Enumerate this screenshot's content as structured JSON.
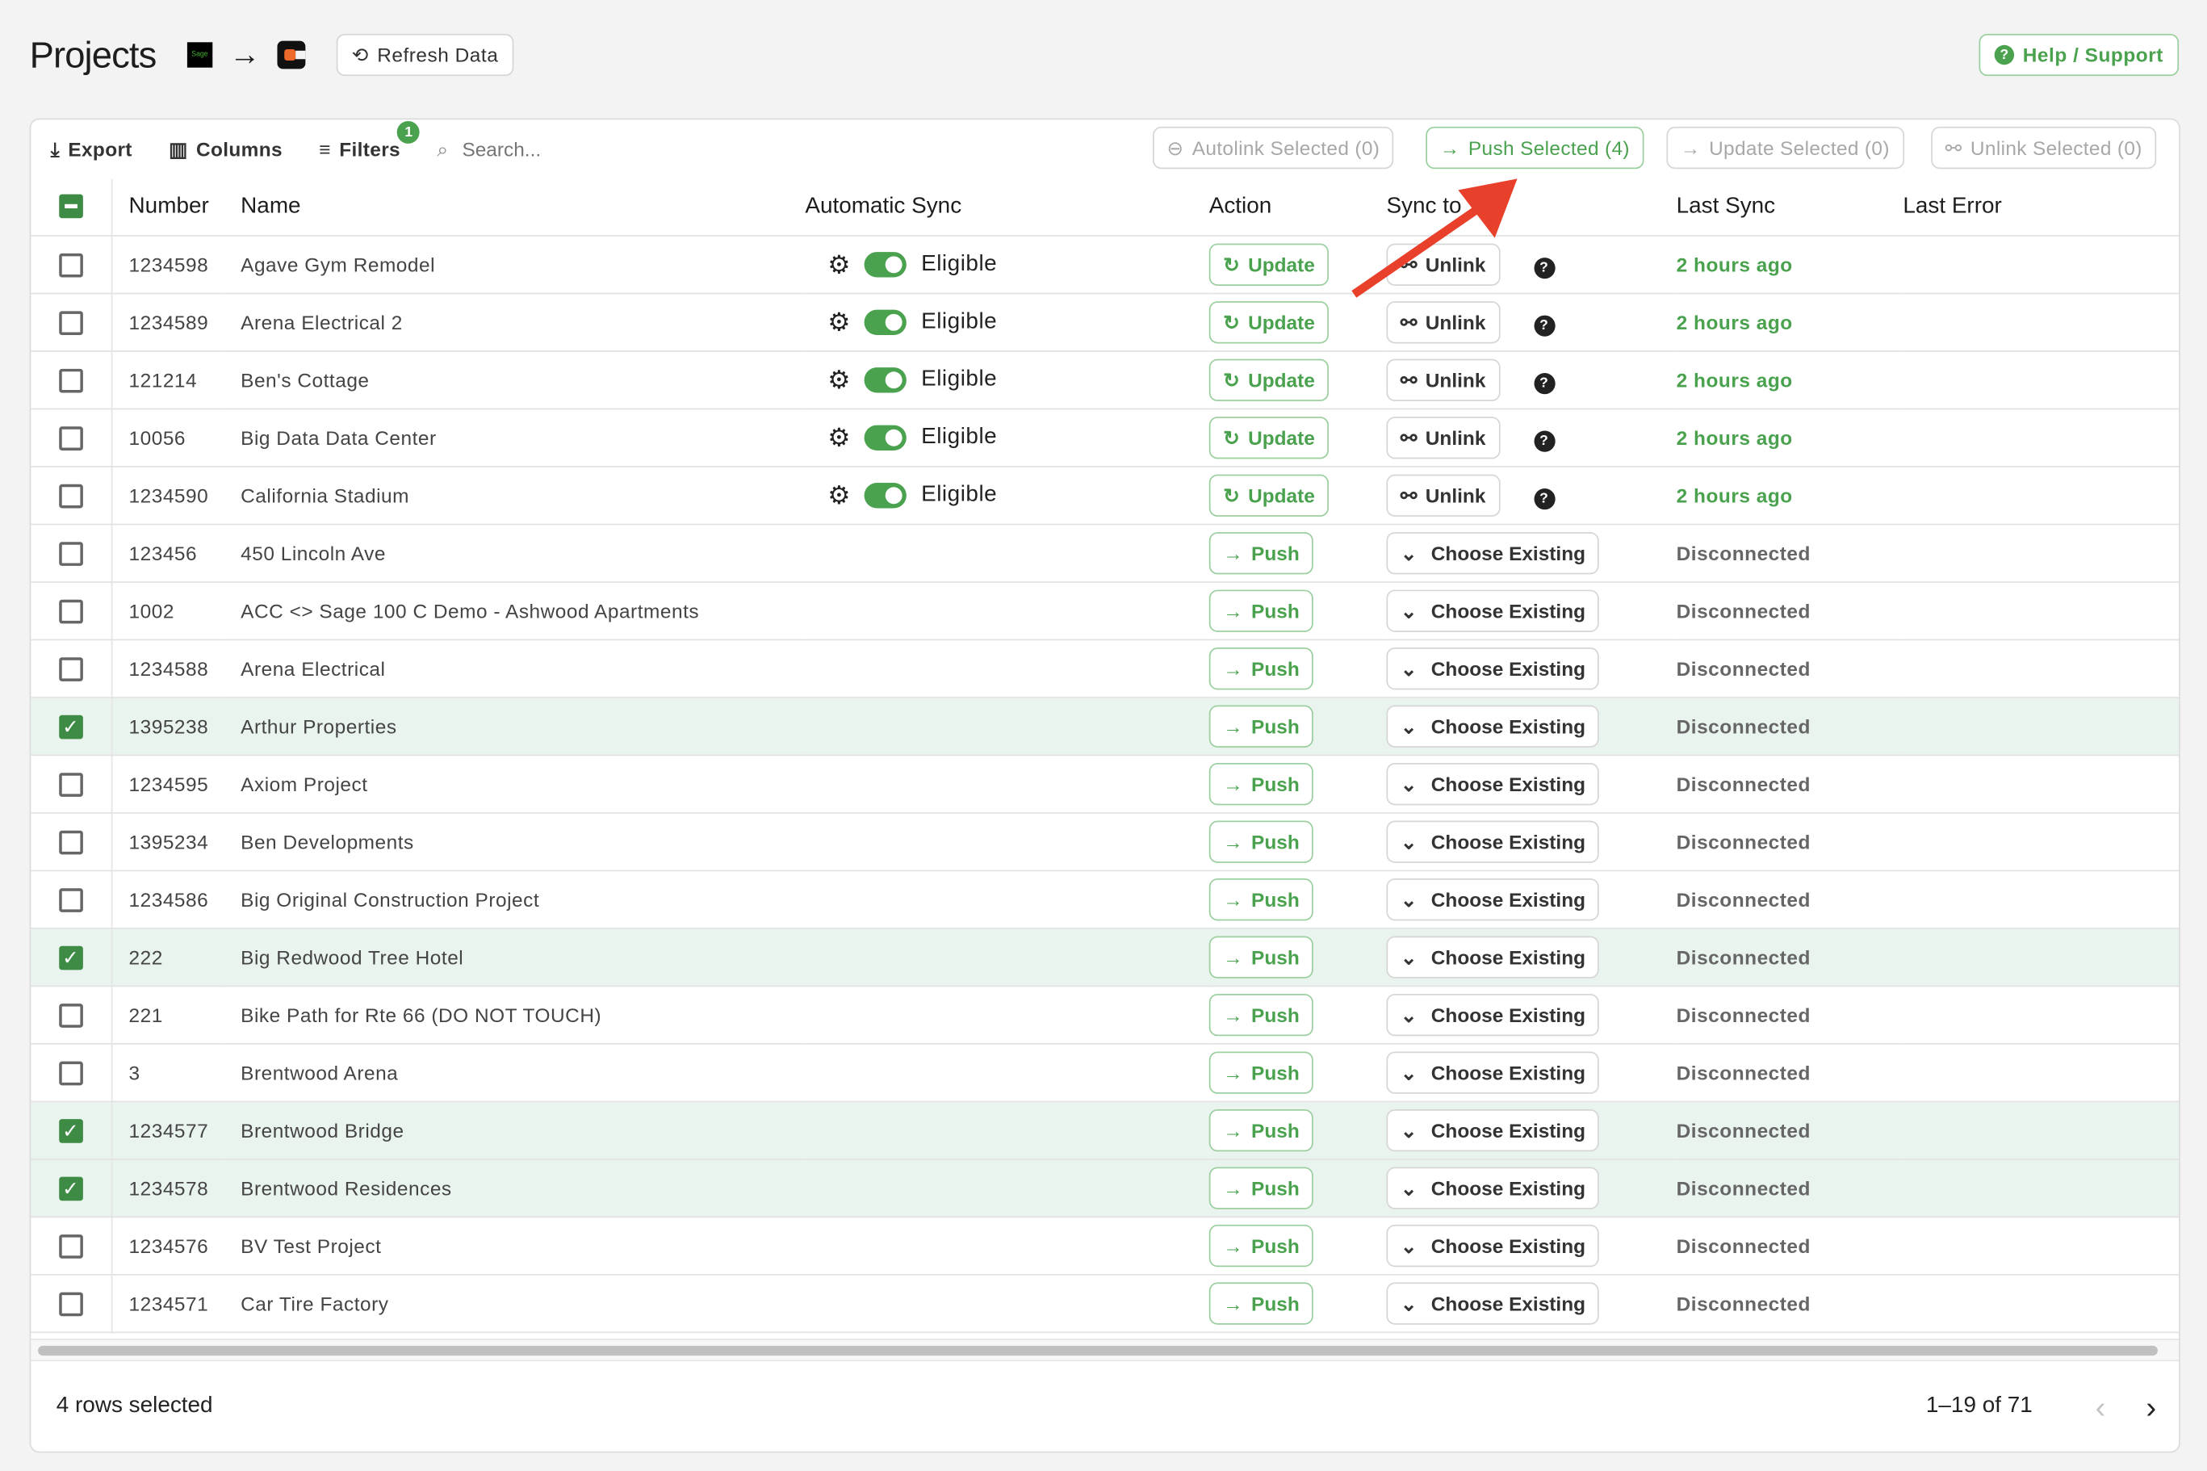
{
  "header": {
    "title": "Projects",
    "source_logo": "Sage",
    "refresh_label": "Refresh Data",
    "help_label": "Help / Support"
  },
  "toolbar": {
    "export_label": "Export",
    "columns_label": "Columns",
    "filters_label": "Filters",
    "filters_count": "1",
    "search_placeholder": "Search...",
    "autolink_label": "Autolink Selected (0)",
    "push_label": "Push Selected (4)",
    "update_label": "Update Selected (0)",
    "unlink_label": "Unlink Selected (0)"
  },
  "columns": [
    "Number",
    "Name",
    "Automatic Sync",
    "Action",
    "Sync to",
    "Last Sync",
    "Last Error"
  ],
  "labels": {
    "eligible": "Eligible",
    "update": "Update",
    "unlink": "Unlink",
    "push": "Push",
    "choose_existing": "Choose Existing"
  },
  "rows": [
    {
      "number": "1234598",
      "name": "Agave Gym Remodel",
      "linked": true,
      "selected": false,
      "last_sync": "2 hours ago"
    },
    {
      "number": "1234589",
      "name": "Arena Electrical 2",
      "linked": true,
      "selected": false,
      "last_sync": "2 hours ago"
    },
    {
      "number": "121214",
      "name": "Ben's Cottage",
      "linked": true,
      "selected": false,
      "last_sync": "2 hours ago"
    },
    {
      "number": "10056",
      "name": "Big Data Data Center",
      "linked": true,
      "selected": false,
      "last_sync": "2 hours ago"
    },
    {
      "number": "1234590",
      "name": "California Stadium",
      "linked": true,
      "selected": false,
      "last_sync": "2 hours ago"
    },
    {
      "number": "123456",
      "name": "450 Lincoln Ave",
      "linked": false,
      "selected": false,
      "last_sync": "Disconnected"
    },
    {
      "number": "1002",
      "name": "ACC <> Sage 100 C Demo - Ashwood Apartments",
      "linked": false,
      "selected": false,
      "last_sync": "Disconnected"
    },
    {
      "number": "1234588",
      "name": "Arena Electrical",
      "linked": false,
      "selected": false,
      "last_sync": "Disconnected"
    },
    {
      "number": "1395238",
      "name": "Arthur Properties",
      "linked": false,
      "selected": true,
      "last_sync": "Disconnected"
    },
    {
      "number": "1234595",
      "name": "Axiom Project",
      "linked": false,
      "selected": false,
      "last_sync": "Disconnected"
    },
    {
      "number": "1395234",
      "name": "Ben Developments",
      "linked": false,
      "selected": false,
      "last_sync": "Disconnected"
    },
    {
      "number": "1234586",
      "name": "Big Original Construction Project",
      "linked": false,
      "selected": false,
      "last_sync": "Disconnected"
    },
    {
      "number": "222",
      "name": "Big Redwood Tree Hotel",
      "linked": false,
      "selected": true,
      "last_sync": "Disconnected"
    },
    {
      "number": "221",
      "name": "Bike Path for Rte 66 (DO NOT TOUCH)",
      "linked": false,
      "selected": false,
      "last_sync": "Disconnected"
    },
    {
      "number": "3",
      "name": "Brentwood Arena",
      "linked": false,
      "selected": false,
      "last_sync": "Disconnected"
    },
    {
      "number": "1234577",
      "name": "Brentwood Bridge",
      "linked": false,
      "selected": true,
      "last_sync": "Disconnected"
    },
    {
      "number": "1234578",
      "name": "Brentwood Residences",
      "linked": false,
      "selected": true,
      "last_sync": "Disconnected"
    },
    {
      "number": "1234576",
      "name": "BV Test Project",
      "linked": false,
      "selected": false,
      "last_sync": "Disconnected"
    },
    {
      "number": "1234571",
      "name": "Car Tire Factory",
      "linked": false,
      "selected": false,
      "last_sync": "Disconnected"
    }
  ],
  "footer": {
    "rows_selected": "4 rows selected",
    "pagination": "1–19 of 71"
  },
  "colors": {
    "accent_green": "#4aa24f",
    "checkbox_green": "#3e8b45",
    "annotation_arrow": "#e8402a"
  }
}
